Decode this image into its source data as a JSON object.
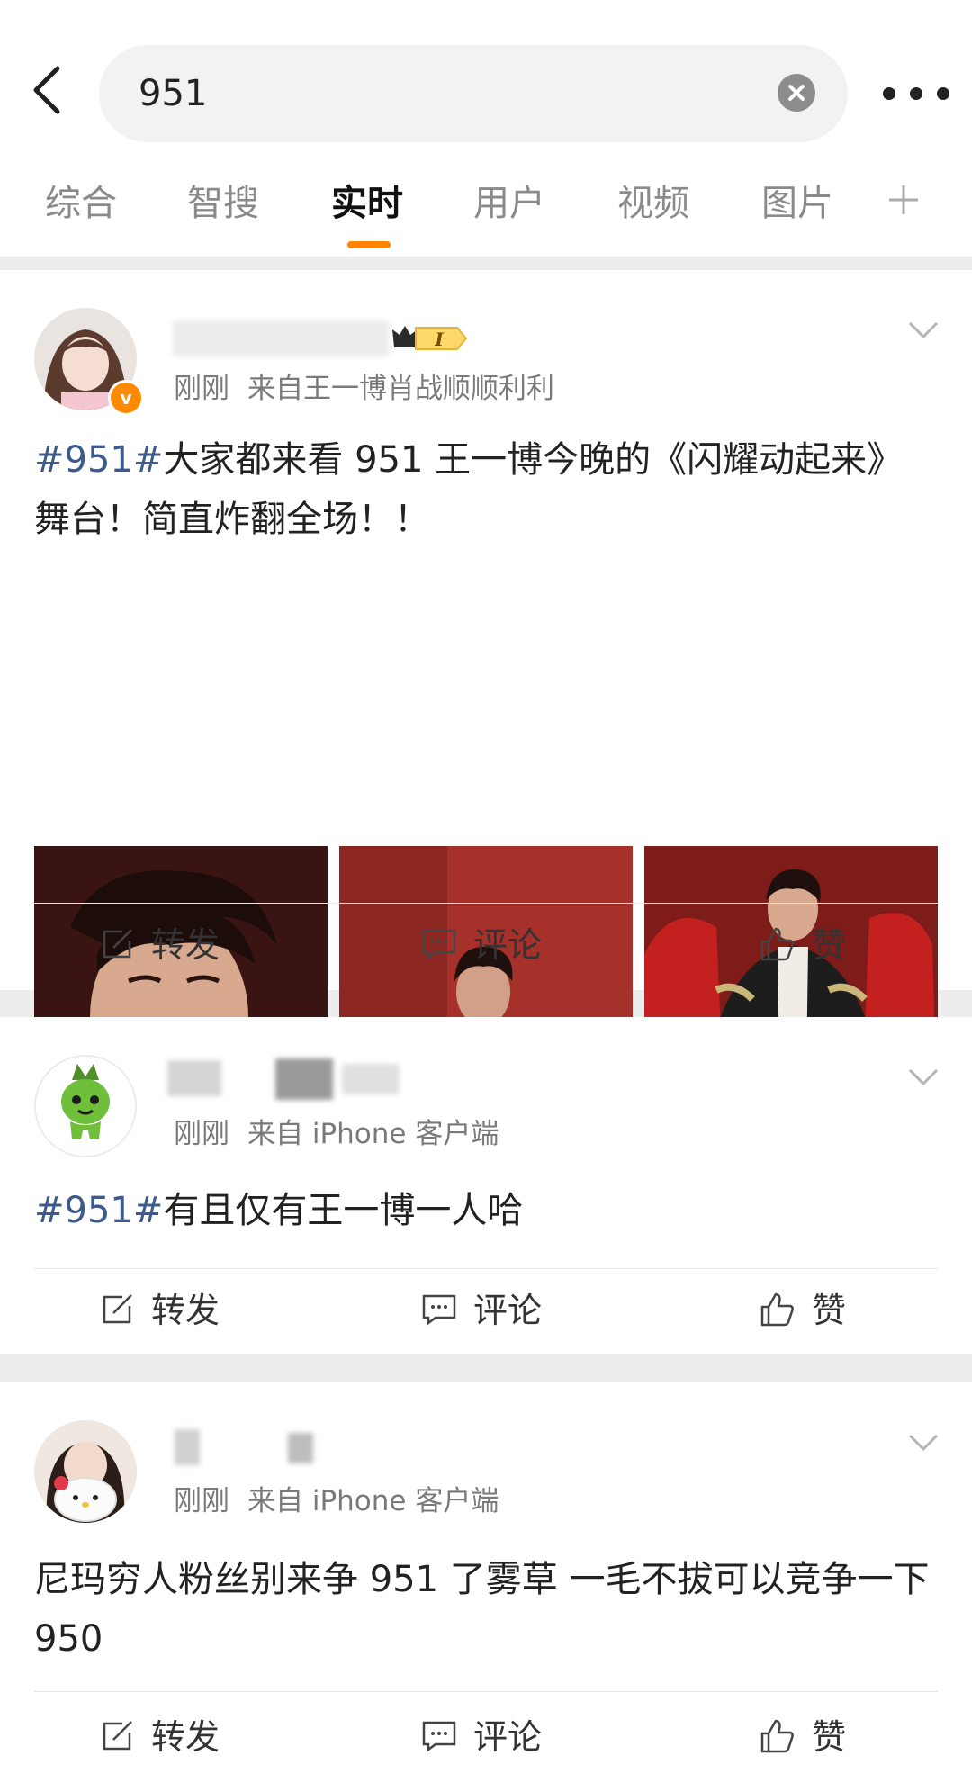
{
  "search": {
    "query": "951"
  },
  "tabs": [
    {
      "label": "综合"
    },
    {
      "label": "智搜"
    },
    {
      "label": "实时",
      "active": true
    },
    {
      "label": "用户"
    },
    {
      "label": "视频"
    },
    {
      "label": "图片"
    }
  ],
  "actions": {
    "repost": "转发",
    "comment": "评论",
    "like": "赞"
  },
  "posts": [
    {
      "time": "刚刚",
      "source": "来自王一博肖战顺顺利利",
      "hashtag": "#951#",
      "text": "大家都来看 951 王一博今晚的《闪耀动起来》舞台！简直炸翻全场！！",
      "level_badge": "I"
    },
    {
      "time": "刚刚",
      "source": "来自 iPhone 客户端",
      "hashtag": "#951#",
      "text": "有且仅有王一博一人哈"
    },
    {
      "time": "刚刚",
      "source": "来自 iPhone 客户端",
      "text": "尼玛穷人粉丝别来争 951 了雾草 一毛不拔可以竞争一下 950"
    }
  ],
  "colors": {
    "accent": "#ff8200",
    "hashtag": "#3c5a8c",
    "badge": "#ff8a00"
  }
}
